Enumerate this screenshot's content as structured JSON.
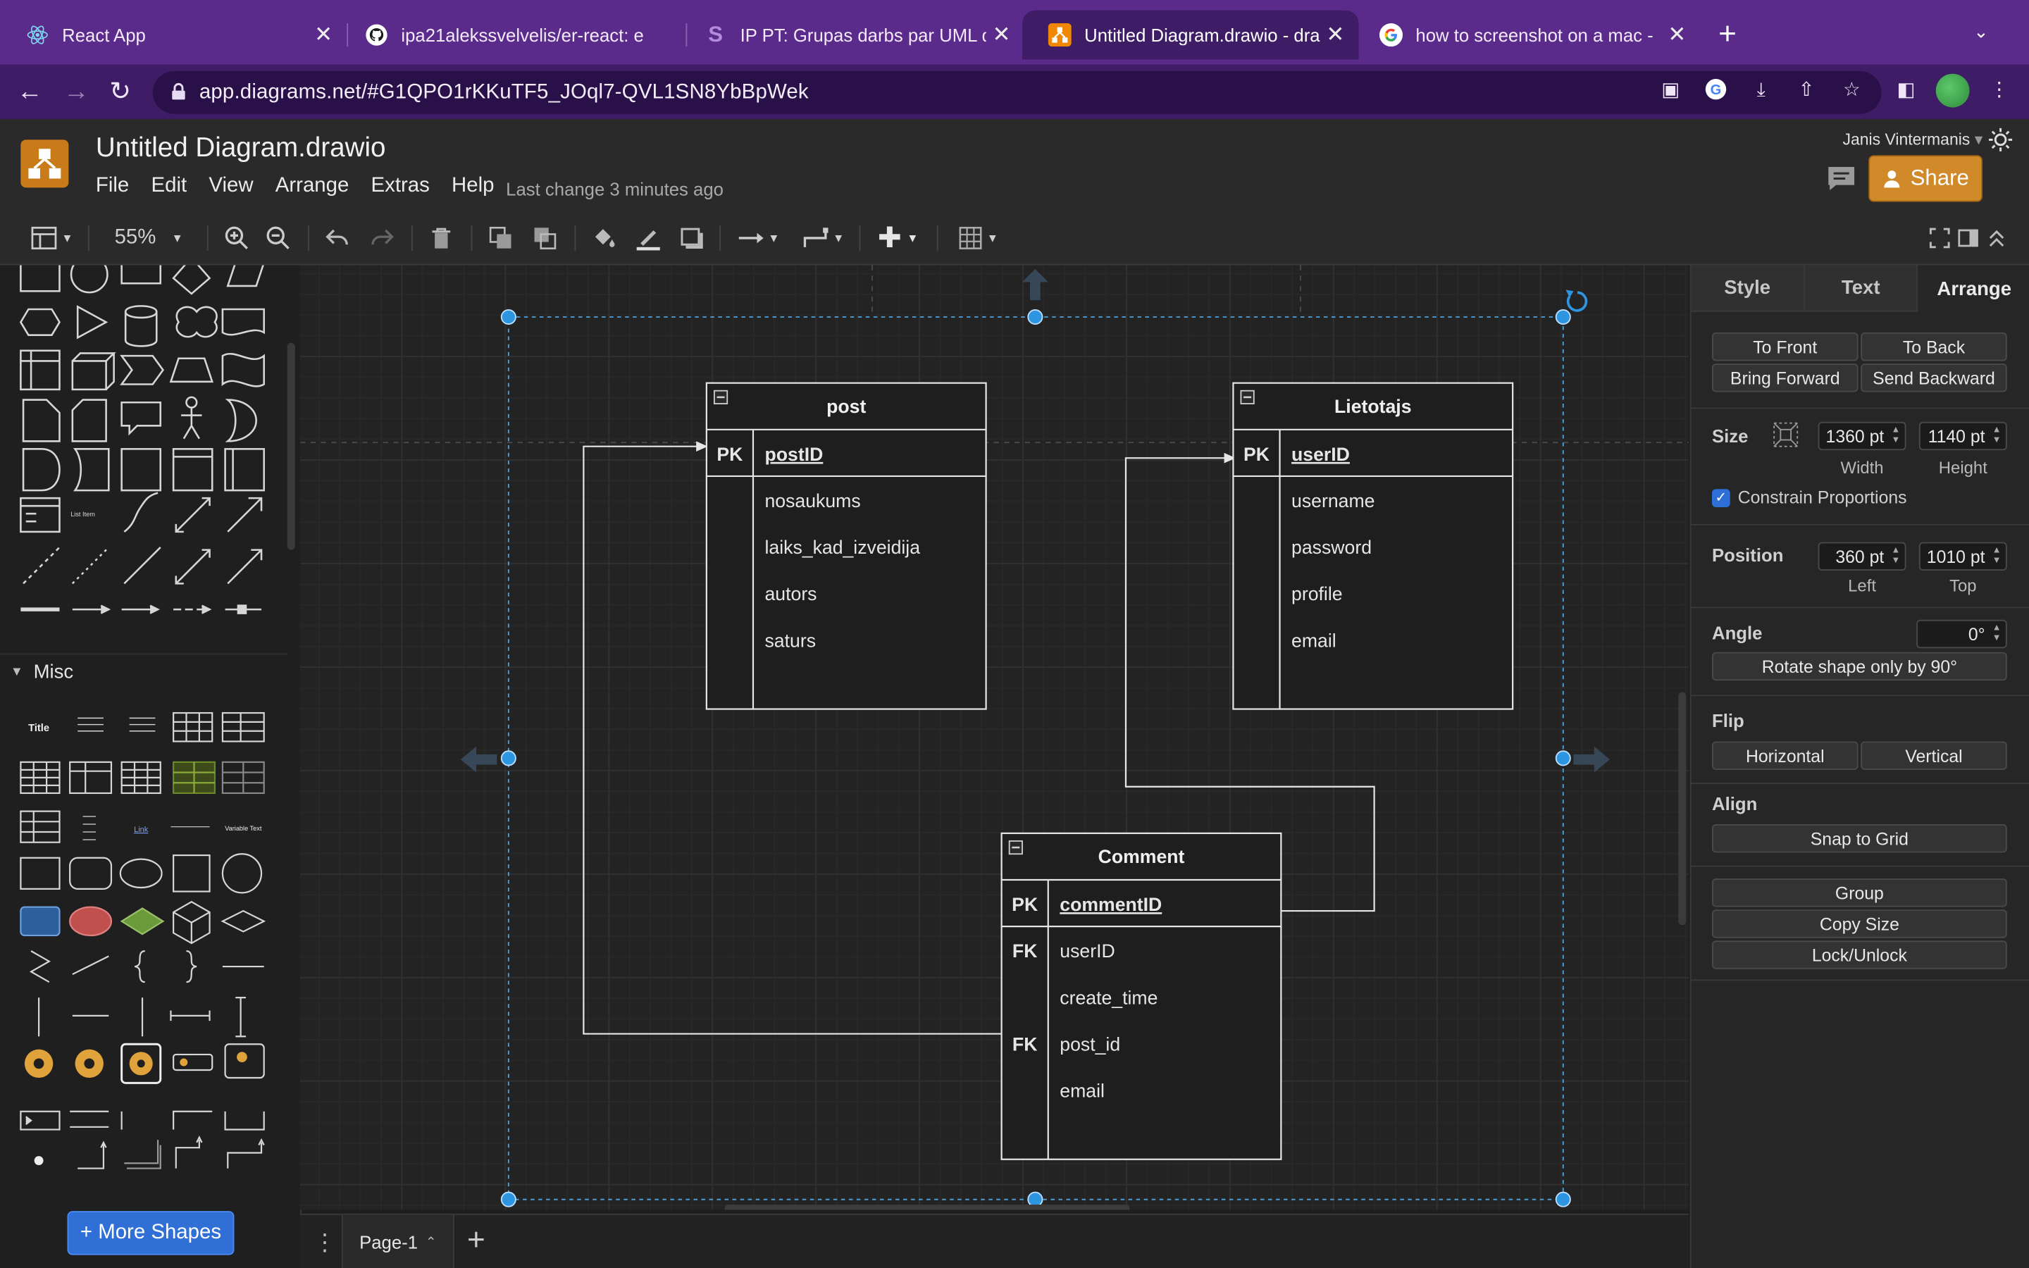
{
  "browser": {
    "tabs": [
      {
        "title": "React App",
        "icon": "react-icon"
      },
      {
        "title": "ipa21alekssvelvelis/er-react: e",
        "icon": "github-icon"
      },
      {
        "title": "IP PT: Grupas darbs par UML d",
        "icon": "s-icon"
      },
      {
        "title": "Untitled Diagram.drawio - draw",
        "icon": "drawio-icon",
        "active": true
      },
      {
        "title": "how to screenshot on a mac -",
        "icon": "google-icon"
      }
    ],
    "url": "app.diagrams.net/#G1QPO1rKKuTF5_JOql7-QVL1SN8YbBpWek",
    "colors": {
      "tabstrip": "#5b2b8c",
      "toolbar": "#3f1d66"
    }
  },
  "app": {
    "title": "Untitled Diagram.drawio",
    "menu": [
      "File",
      "Edit",
      "View",
      "Arrange",
      "Extras",
      "Help"
    ],
    "last_change": "Last change 3 minutes ago",
    "user": "Janis Vintermanis",
    "share_label": "Share"
  },
  "toolbar": {
    "zoom": "55%"
  },
  "sidebar": {
    "section_misc": "Misc",
    "more_shapes": "+ More Shapes",
    "shape_labels": {
      "list_item": "List Item",
      "title": "Title",
      "link": "Link",
      "variable_text": "Variable Text"
    }
  },
  "diagram": {
    "tables": [
      {
        "name": "post",
        "rows": [
          {
            "key": "PK",
            "field": "postID",
            "primary": true
          },
          {
            "key": "",
            "field": "nosaukums"
          },
          {
            "key": "",
            "field": "laiks_kad_izveidija"
          },
          {
            "key": "",
            "field": "autors"
          },
          {
            "key": "",
            "field": "saturs"
          }
        ]
      },
      {
        "name": "Lietotajs",
        "rows": [
          {
            "key": "PK",
            "field": "userID",
            "primary": true
          },
          {
            "key": "",
            "field": "username"
          },
          {
            "key": "",
            "field": "password"
          },
          {
            "key": "",
            "field": "profile"
          },
          {
            "key": "",
            "field": "email"
          }
        ]
      },
      {
        "name": "Comment",
        "rows": [
          {
            "key": "PK",
            "field": "commentID",
            "primary": true
          },
          {
            "key": "FK",
            "field": "userID"
          },
          {
            "key": "",
            "field": "create_time"
          },
          {
            "key": "FK",
            "field": "post_id"
          },
          {
            "key": "",
            "field": "email"
          }
        ]
      }
    ]
  },
  "pages": {
    "current": "Page-1"
  },
  "format_panel": {
    "tabs": [
      "Style",
      "Text",
      "Arrange"
    ],
    "active_tab": "Arrange",
    "order_buttons": [
      "To Front",
      "To Back",
      "Bring Forward",
      "Send Backward"
    ],
    "size_label": "Size",
    "width": "1360 pt",
    "height": "1140 pt",
    "width_label": "Width",
    "height_label": "Height",
    "constrain": "Constrain Proportions",
    "position_label": "Position",
    "left": "360 pt",
    "top": "1010 pt",
    "left_label": "Left",
    "top_label": "Top",
    "angle_label": "Angle",
    "angle": "0°",
    "rotate_label": "Rotate shape only by 90°",
    "flip_label": "Flip",
    "flip_h": "Horizontal",
    "flip_v": "Vertical",
    "align_label": "Align",
    "snap": "Snap to Grid",
    "group": "Group",
    "copy_size": "Copy Size",
    "lock": "Lock/Unlock"
  }
}
